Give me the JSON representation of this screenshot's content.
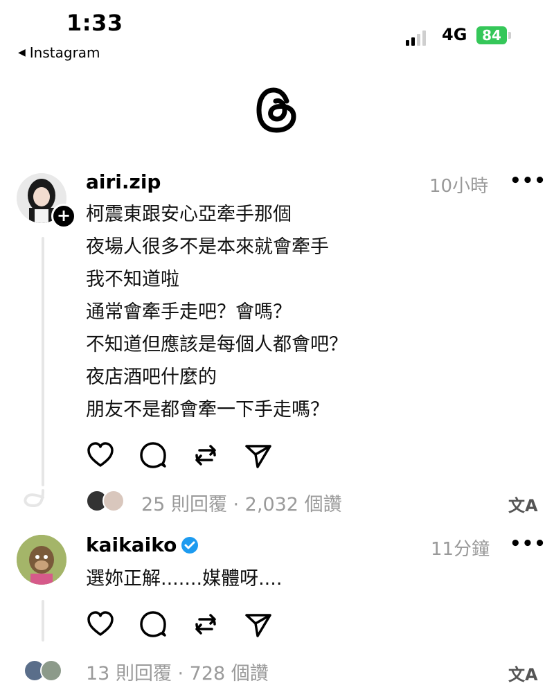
{
  "status_bar": {
    "time": "1:33",
    "back_app": "Instagram",
    "network": "4G",
    "battery": "84"
  },
  "posts": [
    {
      "username": "airi.zip",
      "timestamp": "10小時",
      "more": "•••",
      "lines": [
        "柯震東跟安心亞牽手那個",
        "夜場人很多不是本來就會牽手",
        "我不知道啦",
        "通常會牽手走吧？會嗎？",
        "不知道但應該是每個人都會吧？",
        "夜店酒吧什麼的",
        "朋友不是都會牽一下手走嗎？"
      ],
      "stats": "25 則回覆 · 2,032 個讚",
      "translate": "文A"
    },
    {
      "username": "kaikaiko",
      "verified": true,
      "timestamp": "11分鐘",
      "more": "•••",
      "lines": [
        "選妳正解.......媒體呀...."
      ],
      "stats": "13 則回覆 · 728 個讚",
      "translate": "文A"
    }
  ],
  "icons": {
    "logo": "threads-logo-icon",
    "like": "heart-icon",
    "comment": "comment-bubble-icon",
    "repost": "repost-icon",
    "share": "send-icon"
  },
  "colors": {
    "battery": "#35c759",
    "verified": "#1d9bf0",
    "muted": "#999999"
  }
}
